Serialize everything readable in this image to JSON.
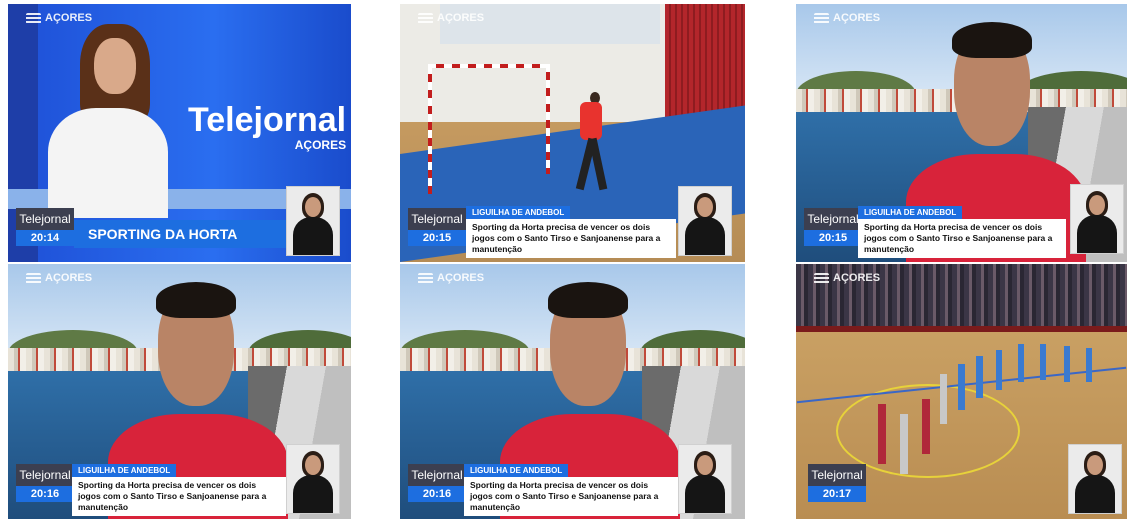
{
  "logo": {
    "text": "AÇORES"
  },
  "frames": [
    {
      "id": "f1",
      "program": "Telejornal",
      "time": "20:14",
      "headline": "SPORTING DA HORTA",
      "brand_title": "Telejornal",
      "brand_sub": "AÇORES"
    },
    {
      "id": "f2",
      "program": "Telejornal",
      "time": "20:15",
      "kicker": "LIGUILHA DE ANDEBOL",
      "headline": "Sporting da Horta precisa de vencer os dois jogos com o Santo Tirso e Sanjoanense para a manutenção"
    },
    {
      "id": "f3",
      "program": "Telejornal",
      "time": "20:15",
      "kicker": "LIGUILHA DE ANDEBOL",
      "headline": "Sporting da Horta precisa de vencer os dois jogos com o Santo Tirso e Sanjoanense para a manutenção"
    },
    {
      "id": "f4",
      "program": "Telejornal",
      "time": "20:16",
      "kicker": "LIGUILHA DE ANDEBOL",
      "headline": "Sporting da Horta precisa de vencer os dois jogos com o Santo Tirso e Sanjoanense para a manutenção"
    },
    {
      "id": "f5",
      "program": "Telejornal",
      "time": "20:16",
      "kicker": "LIGUILHA DE ANDEBOL",
      "headline": "Sporting da Horta precisa de vencer os dois jogos com o Santo Tirso e Sanjoanense para a manutenção"
    },
    {
      "id": "f6",
      "program": "Telejornal",
      "time": "20:17"
    }
  ],
  "colors": {
    "accent_blue": "#1d6ee0",
    "program_box": "#3c3f50",
    "shirt_red": "#d8233a"
  }
}
